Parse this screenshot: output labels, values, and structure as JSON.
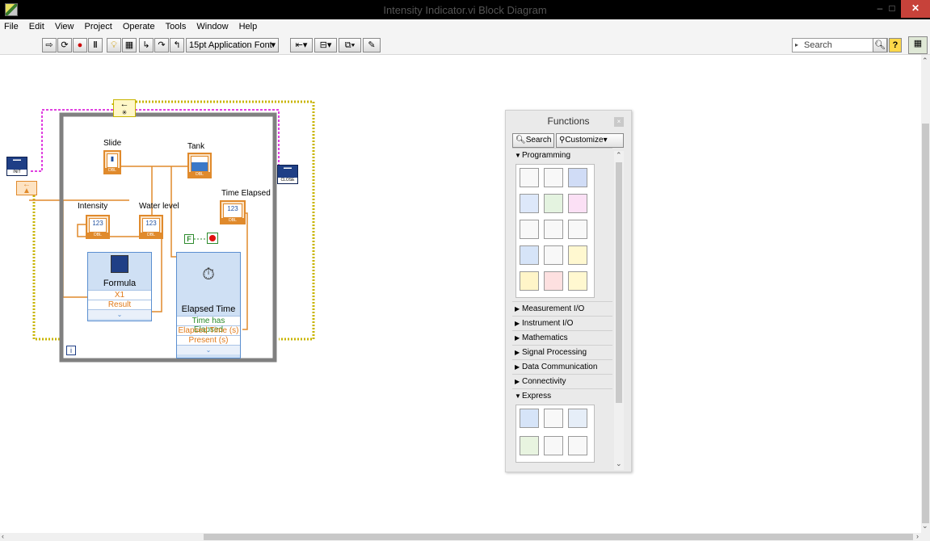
{
  "window": {
    "title": "Intensity Indicator.vi Block Diagram",
    "minimize_glyph": "–",
    "maximize_glyph": "□",
    "close_glyph": "✕"
  },
  "menu": [
    "File",
    "Edit",
    "View",
    "Project",
    "Operate",
    "Tools",
    "Window",
    "Help"
  ],
  "toolbar": {
    "font_selector": "15pt Application Font",
    "search_placeholder": "Search"
  },
  "diagram": {
    "labels": {
      "slide": "Slide",
      "tank": "Tank",
      "intensity": "Intensity",
      "water_level": "Water level",
      "time_elapsed": "Time Elapsed"
    },
    "terminals": {
      "intensity_value": "123",
      "water_level_value": "123",
      "time_elapsed_value": "123",
      "dbl": "DBL"
    },
    "formula": {
      "title": "Formula",
      "input": "X1",
      "output": "Result"
    },
    "elapsed_time": {
      "title": "Elapsed Time",
      "outputs": [
        "Time has Elapsed",
        "Elapsed Time (s)",
        "Present (s)"
      ]
    },
    "stop_constant": "F",
    "loop_iteration": "i",
    "init_chip": "INIT",
    "close_chip": "CLOSE",
    "shift_register_glyph": "←"
  },
  "functions_palette": {
    "title": "Functions",
    "search_button": "Search",
    "customize_button": "Customize",
    "categories": [
      {
        "label": "Programming",
        "expanded": true
      },
      {
        "label": "Measurement I/O",
        "expanded": false
      },
      {
        "label": "Instrument I/O",
        "expanded": false
      },
      {
        "label": "Mathematics",
        "expanded": false
      },
      {
        "label": "Signal Processing",
        "expanded": false
      },
      {
        "label": "Data Communication",
        "expanded": false
      },
      {
        "label": "Connectivity",
        "expanded": false
      },
      {
        "label": "Express",
        "expanded": true
      }
    ]
  },
  "colors": {
    "wire_orange": "#e08a2c",
    "wire_green": "#2e8b2e",
    "wire_pink": "#e040e0",
    "wire_yellow": "#c8b400",
    "loop_gray": "#808080",
    "express_blue": "#5b8fd0"
  }
}
